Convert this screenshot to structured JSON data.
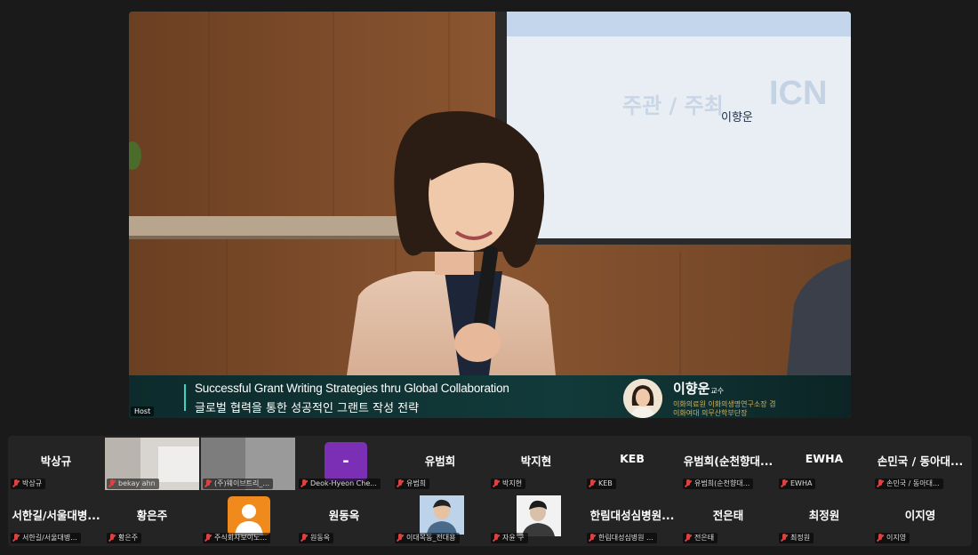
{
  "window": {
    "host_label": "Host"
  },
  "stage": {
    "slide_name": "이향운",
    "lower_third": {
      "title_en": "Successful Grant Writing Strategies thru Global Collaboration",
      "title_ko": "글로벌 협력을 통한 성공적인 그랜트 작성 전략",
      "speaker_name": "이향운",
      "speaker_suffix": "교수",
      "affiliation_1": "이화의료원 이화의생명연구소장 겸",
      "affiliation_2": "이화여대 의무산학부단장"
    }
  },
  "participants": [
    {
      "big": "박상규",
      "label": "박상규"
    },
    {
      "big": "",
      "label": "bekay ahn"
    },
    {
      "big": "",
      "label": "(주)웨이브트리_..."
    },
    {
      "big": "",
      "label": "Deok-Hyeon Che..."
    },
    {
      "big": "유범희",
      "label": "유범희"
    },
    {
      "big": "박지현",
      "label": "박지현"
    },
    {
      "big": "KEB",
      "label": "KEB"
    },
    {
      "big": "유범희(순천향대...",
      "label": "유범희(순천향대..."
    },
    {
      "big": "EWHA",
      "label": "EWHA"
    },
    {
      "big": "손민국 / 동아대...",
      "label": "손민국 / 동아대..."
    },
    {
      "big": "서한길/서울대병...",
      "label": "서한길/서울대병..."
    },
    {
      "big": "황은주",
      "label": "황은주"
    },
    {
      "big": "",
      "label": "주식회사보이노..."
    },
    {
      "big": "원동옥",
      "label": "원동옥"
    },
    {
      "big": "",
      "label": "이대목동_전대용"
    },
    {
      "big": "",
      "label": "자윤 구"
    },
    {
      "big": "한림대성심병원...",
      "label": "한림대성심병원 ..."
    },
    {
      "big": "전은태",
      "label": "전은태"
    },
    {
      "big": "최정원",
      "label": "최정원"
    },
    {
      "big": "이지영",
      "label": "이지영"
    }
  ],
  "colors": {
    "background": "#1a1a1a",
    "gallery_bg": "#242424",
    "mic_muted": "#e04040",
    "lower_third_accent": "#3fd3c3",
    "purple_avatar": "#7b2fb5",
    "orange_avatar": "#f08a1c"
  }
}
